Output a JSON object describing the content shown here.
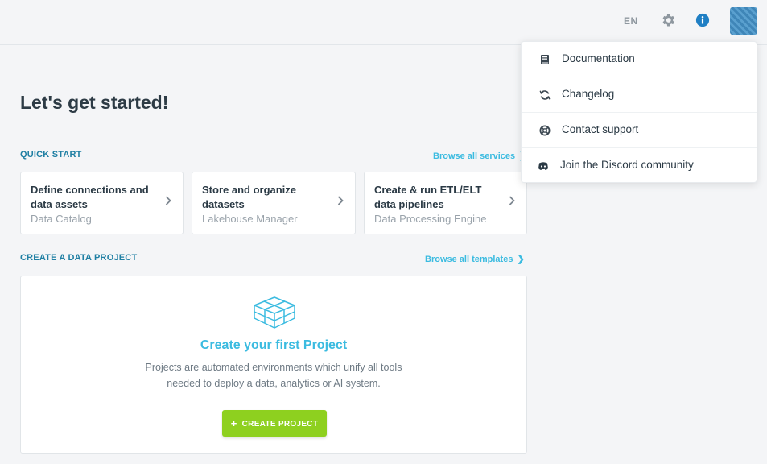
{
  "header": {
    "language": "EN",
    "icons": [
      "gear-icon",
      "info-icon",
      "avatar"
    ]
  },
  "page": {
    "title": "Let's get started!"
  },
  "quick_start": {
    "label": "QUICK START",
    "link": "Browse all services",
    "cards": [
      {
        "title": "Define connections and data assets",
        "subtitle": "Data Catalog"
      },
      {
        "title": "Store and organize datasets",
        "subtitle": "Lakehouse Manager"
      },
      {
        "title": "Create & run ETL/ELT data pipelines",
        "subtitle": "Data Processing Engine"
      }
    ]
  },
  "data_project": {
    "label": "CREATE A DATA PROJECT",
    "link": "Browse all templates",
    "heading": "Create your first Project",
    "description_line1": "Projects are automated environments which unify all tools",
    "description_line2": "needed to deploy a data, analytics or AI system.",
    "button_label": "CREATE PROJECT"
  },
  "help_menu": {
    "items": [
      {
        "label": "Documentation",
        "icon": "book-icon"
      },
      {
        "label": "Changelog",
        "icon": "refresh-icon"
      },
      {
        "label": "Contact support",
        "icon": "lifebuoy-icon"
      },
      {
        "label": "Join the Discord community",
        "icon": "discord-icon"
      }
    ]
  },
  "colors": {
    "accent": "#3bbbe0",
    "section_label": "#1f7fa3",
    "button_green": "#8ed01f"
  }
}
